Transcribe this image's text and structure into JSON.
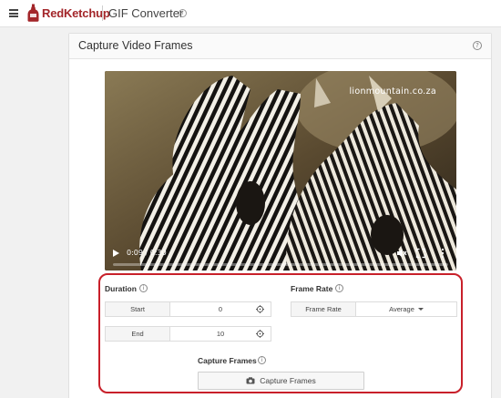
{
  "topbar": {
    "brand": "RedKetchup",
    "app_title": "GIF Converter",
    "info_glyph": "i"
  },
  "card": {
    "title": "Capture Video Frames",
    "help_glyph": "?"
  },
  "video": {
    "watermark": "lionmountain.co.za",
    "time": "0:09 / 0:30",
    "progress": 0.0,
    "icons": [
      "play-icon",
      "mute-icon",
      "fullscreen-icon",
      "more-icon"
    ]
  },
  "duration": {
    "title": "Duration",
    "start_label": "Start",
    "start_value": "0",
    "end_label": "End",
    "end_value": "10"
  },
  "frame_rate": {
    "title": "Frame Rate",
    "label": "Frame Rate",
    "selected": "Average"
  },
  "capture": {
    "title": "Capture Frames",
    "button_label": "Capture Frames"
  },
  "colors": {
    "brand": "#a3262a",
    "highlight": "#c8202a"
  }
}
